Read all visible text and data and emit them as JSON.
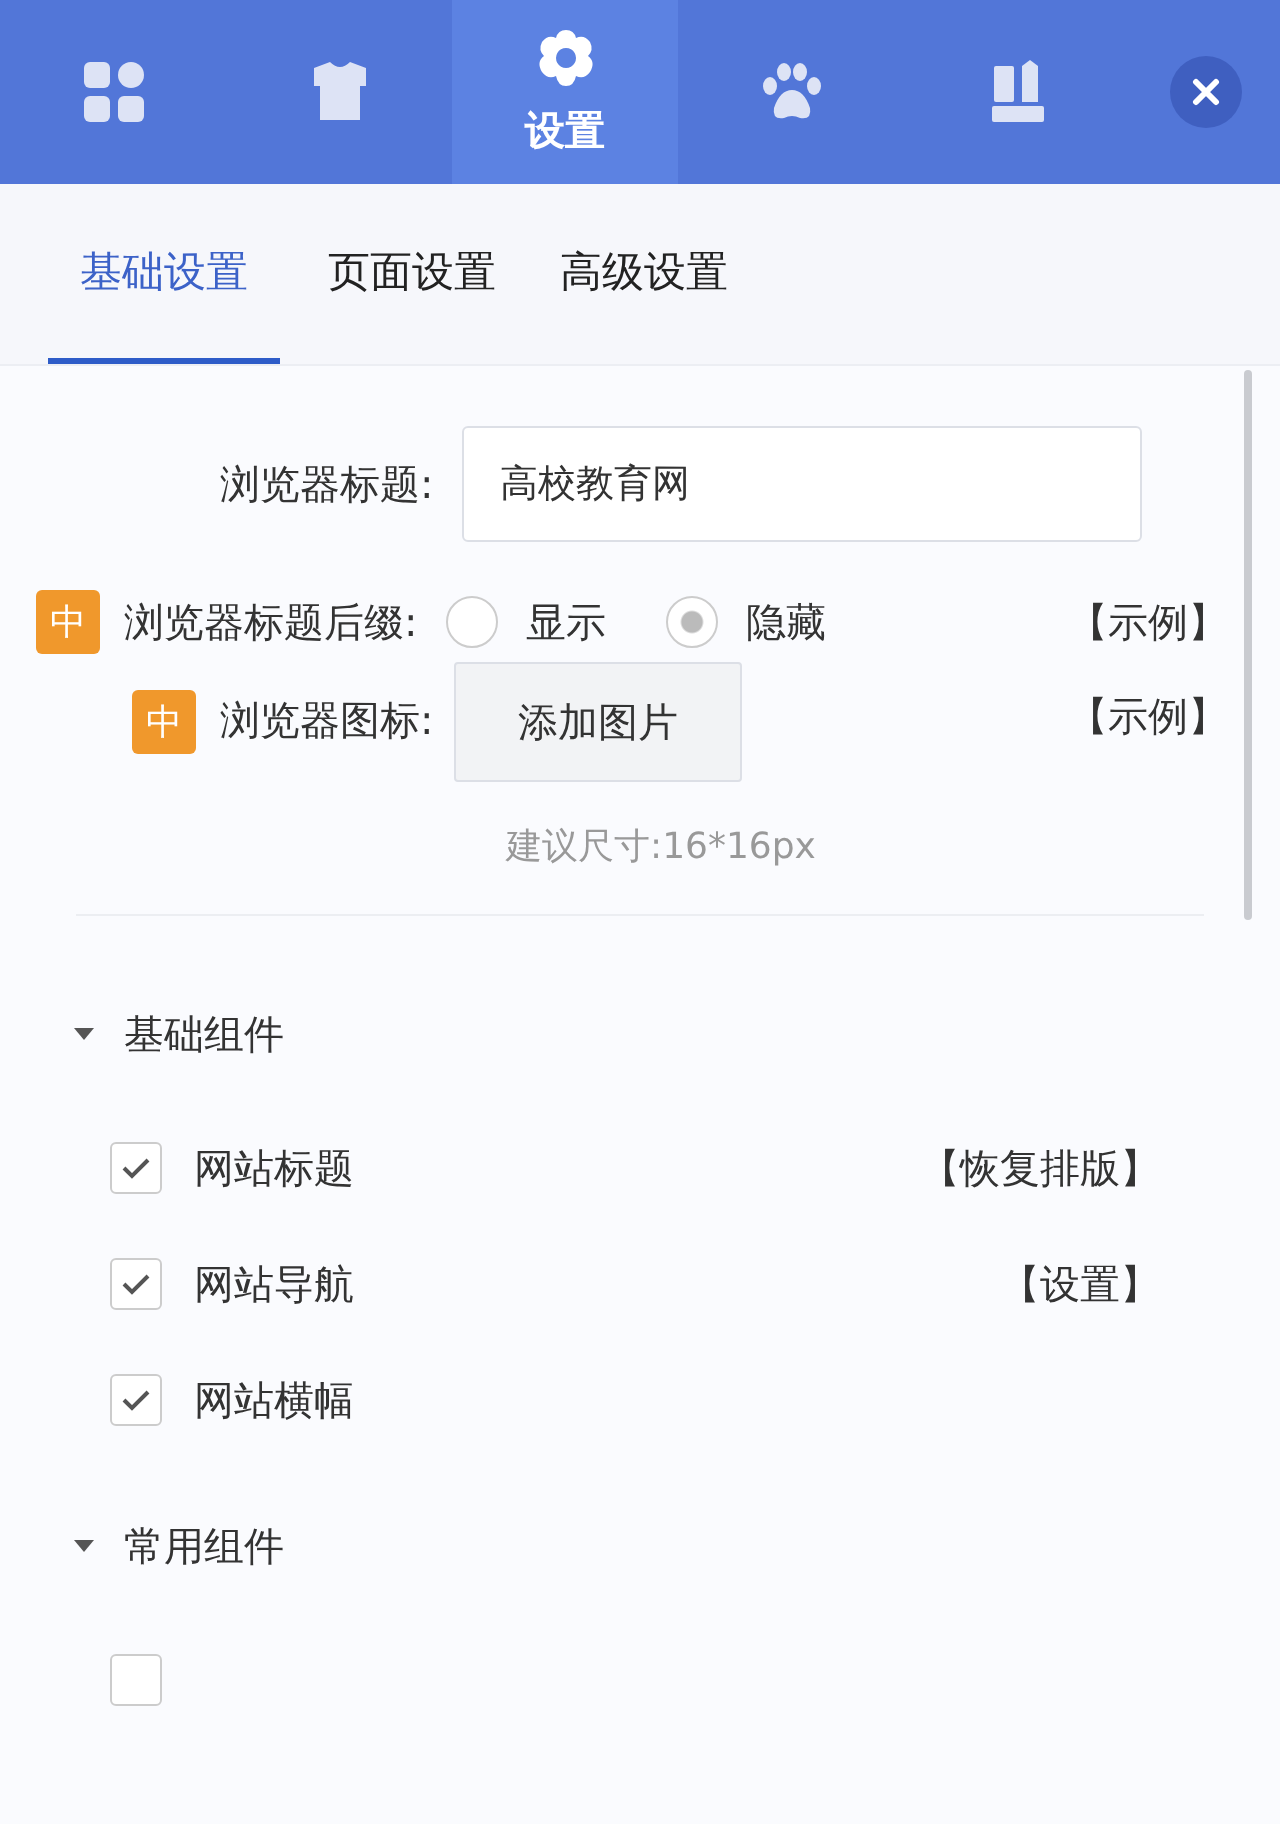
{
  "top_tabs": [
    {
      "kind": "grid",
      "selected": false
    },
    {
      "kind": "shirt",
      "selected": false
    },
    {
      "kind": "gear",
      "label": "设置",
      "selected": true
    },
    {
      "kind": "paw",
      "selected": false
    },
    {
      "kind": "books",
      "selected": false
    }
  ],
  "sub_tabs": [
    {
      "label": "基础设置",
      "selected": true
    },
    {
      "label": "页面设置",
      "selected": false
    },
    {
      "label": "高级设置",
      "selected": false
    }
  ],
  "title_field": {
    "label": "浏览器标题:",
    "value": "高校教育网"
  },
  "suffix": {
    "badge": "中",
    "label": "浏览器标题后缀:",
    "options": [
      {
        "label": "显示",
        "selected": false
      },
      {
        "label": "隐藏",
        "selected": true
      }
    ],
    "link": "【示例】"
  },
  "favicon": {
    "badge": "中",
    "label": "浏览器图标:",
    "button": "添加图片",
    "link": "【示例】",
    "hint": "建议尺寸:16*16px"
  },
  "sections": [
    {
      "title": "基础组件",
      "expanded": true,
      "items": [
        {
          "label": "网站标题",
          "checked": true,
          "action": "【恢复排版】"
        },
        {
          "label": "网站导航",
          "checked": true,
          "action": "【设置】"
        },
        {
          "label": "网站横幅",
          "checked": true
        }
      ]
    },
    {
      "title": "常用组件",
      "expanded": true,
      "items": [
        {
          "checked": false
        }
      ]
    }
  ]
}
